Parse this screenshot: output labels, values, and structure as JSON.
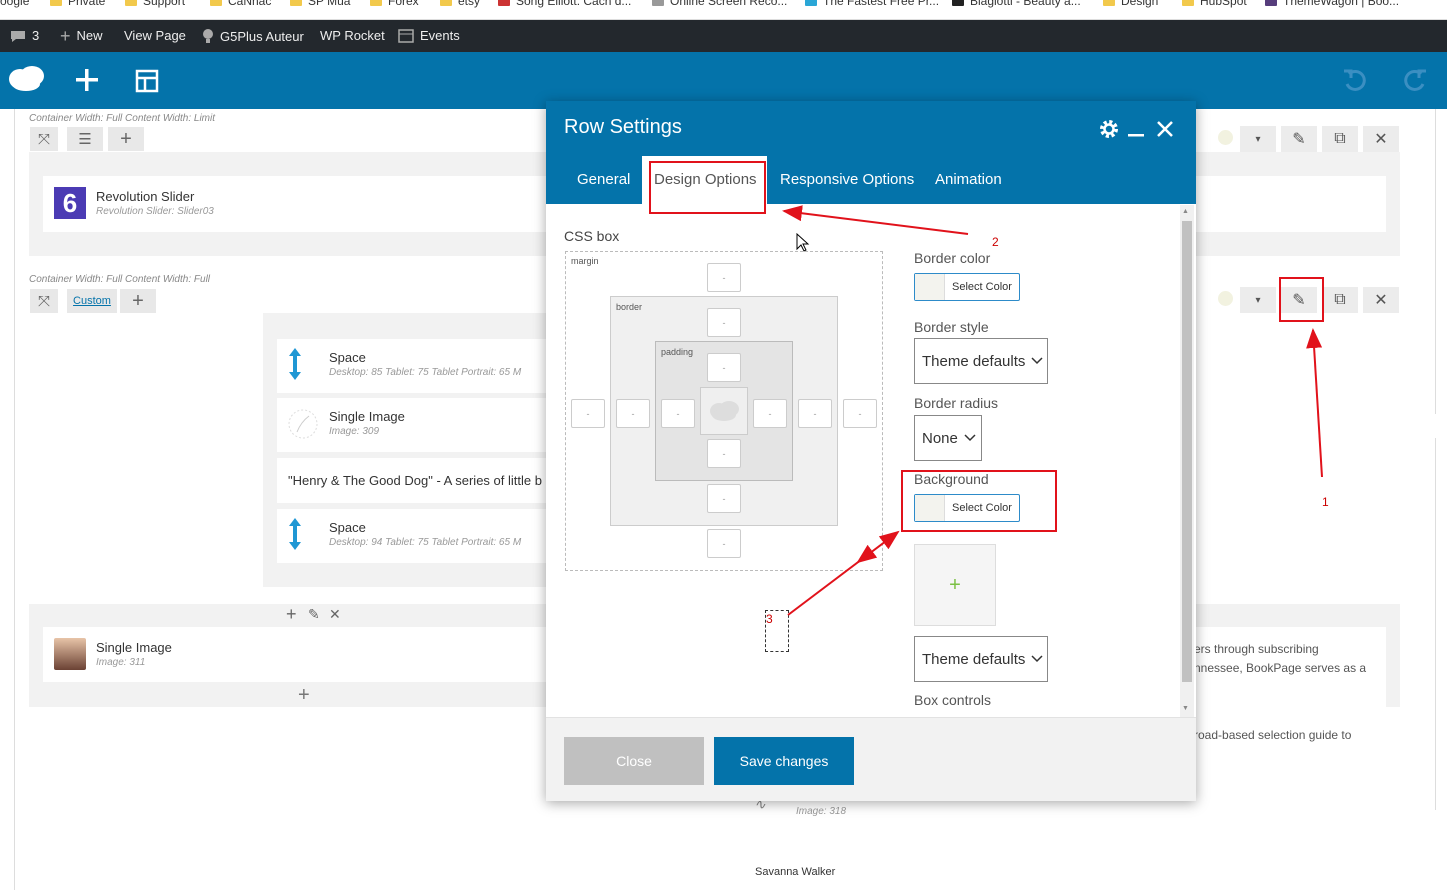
{
  "bookmarks": [
    "oogle",
    "Private",
    "Support",
    "CaNhac",
    "SP Mua",
    "Forex",
    "etsy",
    "Song Elliott: Cach d...",
    "Online Screen Reco...",
    "The Fastest Free Pr...",
    "Blaglotti - Beauty a...",
    "Design",
    "HubSpot",
    "ThemeWagon | Boo..."
  ],
  "adminbar": {
    "comments": "3",
    "new": "New",
    "view_page": "View Page",
    "g5plus": "G5Plus Auteur",
    "wp_rocket": "WP Rocket",
    "events": "Events"
  },
  "editor": {
    "row1_meta": "Container Width: Full  Content Width: Limit",
    "revslider_title": "Revolution Slider",
    "revslider_sub": "Revolution Slider: Slider03",
    "row2_meta": "Container Width: Full  Content Width: Full",
    "custom_label": "Custom",
    "space1_title": "Space",
    "space1_sub": "Desktop: 85  Tablet: 75  Tablet Portrait: 65  M",
    "single1_title": "Single Image",
    "single1_sub": "Image: 309",
    "henry_text": "\"Henry & The Good Dog\" - A series of little b",
    "space2_title": "Space",
    "space2_sub": "Desktop: 94  Tablet: 75  Tablet Portrait: 65  M",
    "single2_title": "Single Image",
    "single2_sub": "Image: 311",
    "right_text1": "ers through subscribing",
    "right_text2": "nnessee, BookPage serves as a",
    "right_text3": "road-based selection guide to",
    "img318_sub": "Image: 318",
    "savanna": "Savanna Walker"
  },
  "modal": {
    "title": "Row Settings",
    "tabs": [
      "General",
      "Design Options",
      "Responsive Options",
      "Animation"
    ],
    "css_box_label": "CSS box",
    "margin_label": "margin",
    "border_label": "border",
    "padding_label": "padding",
    "dash": "-",
    "border_color_label": "Border color",
    "select_color": "Select Color",
    "border_style_label": "Border style",
    "border_style_value": "Theme defaults",
    "border_radius_label": "Border radius",
    "border_radius_value": "None",
    "background_label": "Background",
    "bg_image_plus": "+",
    "bg_style_value": "Theme defaults",
    "box_controls_label": "Box controls",
    "close_label": "Close",
    "save_label": "Save changes"
  },
  "annotations": [
    "1",
    "2",
    "3"
  ],
  "colors": {
    "primary": "#0473aa",
    "adminbar": "#23282d",
    "annotation": "#e1121b"
  }
}
